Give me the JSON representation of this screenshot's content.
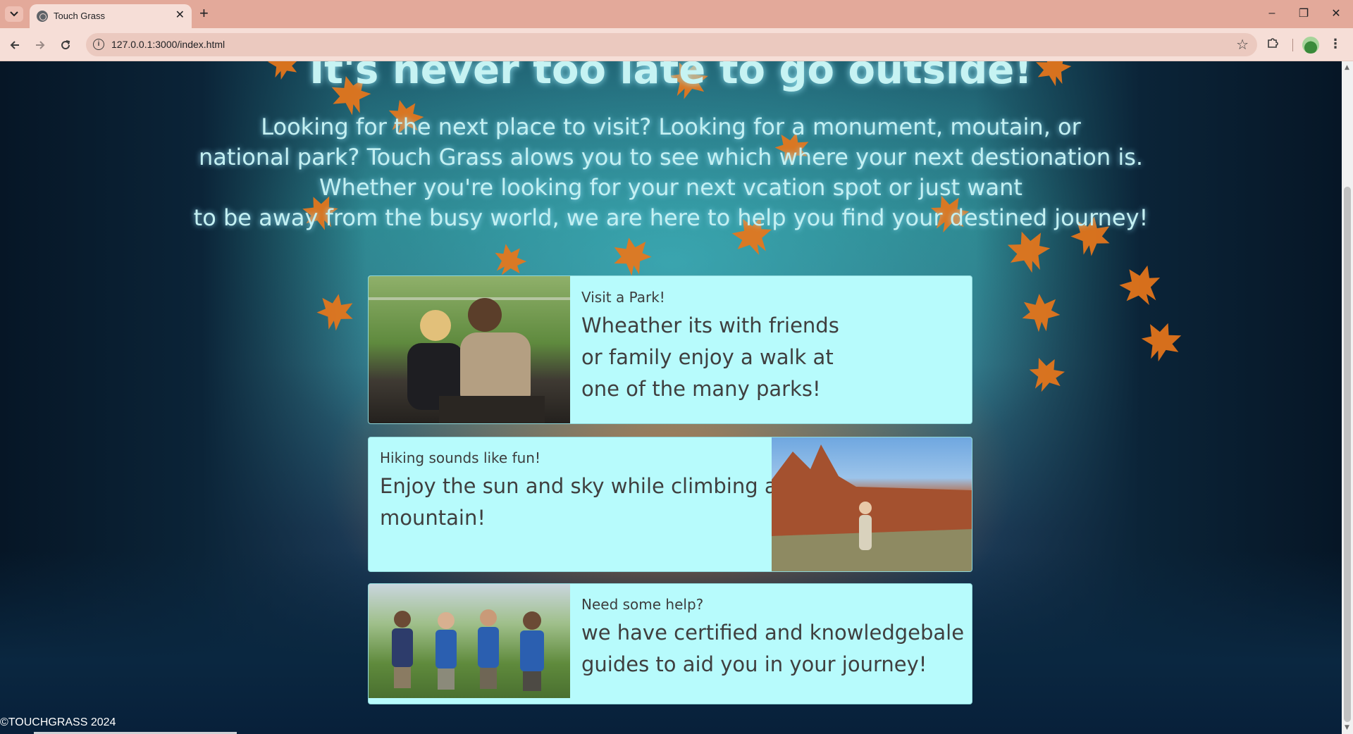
{
  "browser": {
    "tab_title": "Touch Grass",
    "tab_close": "✕",
    "new_tab": "+",
    "url": "127.0.0.1:3000/index.html",
    "window_controls": {
      "minimize": "–",
      "restore": "❐",
      "close": "✕"
    },
    "icons": [
      "tab-list-icon",
      "globe-favicon-icon",
      "back-arrow-icon",
      "forward-arrow-icon",
      "reload-icon",
      "site-info-icon",
      "bookmark-star-icon",
      "extensions-puzzle-icon",
      "profile-avatar-icon",
      "kebab-menu-icon"
    ]
  },
  "page": {
    "heading": "It's never too late to go outside!",
    "intro_lines": [
      "Looking for the next place to visit? Looking for a monument, moutain, or",
      "national park? Touch Grass alows you to see which where your next destionation is.",
      "Whether you're looking for your next vcation spot or just want",
      "to be away from the busy world, we are here to help you find your destined journey!"
    ],
    "cards": [
      {
        "title": "Visit a Park!",
        "lines": [
          "Wheather its with friends",
          "or family enjoy a walk at",
          "one of the many parks!"
        ],
        "image": "two people sitting on a park bench"
      },
      {
        "title": "Hiking sounds like fun!",
        "lines": [
          "Enjoy the sun and sky while climbing a",
          "mountain!"
        ],
        "image": "hiker standing before red rock cliffs"
      },
      {
        "title": "Need some help?",
        "lines": [
          "we have certified and knowledgebale",
          "guides to aid you in your journey!"
        ],
        "image": "group of four guides in blue shirts"
      }
    ],
    "footer": "©TOUCHGRASS 2024"
  },
  "colors": {
    "card_bg": "#b7fbfc",
    "heading_text": "#c6f3f3",
    "chrome_tabbar": "#e3a99a",
    "chrome_toolbar": "#f6ded7",
    "leaf": "#e8761a"
  }
}
